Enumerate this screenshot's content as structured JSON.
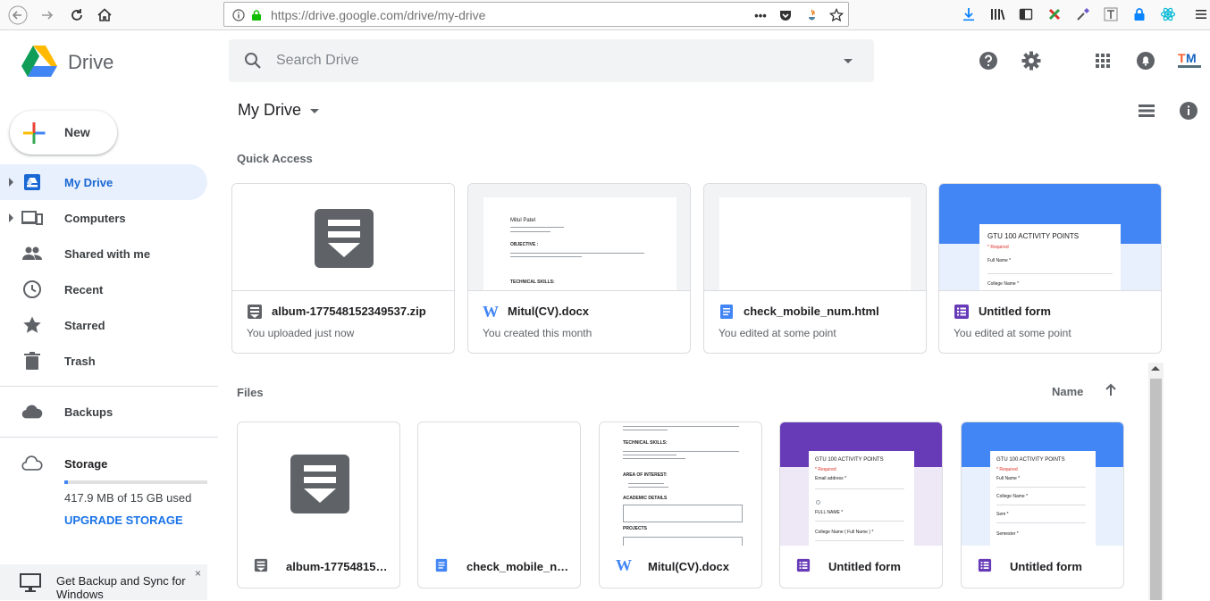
{
  "browser": {
    "url": "https://drive.google.com/drive/my-drive",
    "url_more": "•••"
  },
  "app": {
    "name": "Drive"
  },
  "search": {
    "placeholder": "Search Drive"
  },
  "sidebar": {
    "new_label": "New",
    "items": [
      {
        "label": "My Drive",
        "icon": "my-drive-icon",
        "active": true
      },
      {
        "label": "Computers",
        "icon": "computers-icon"
      },
      {
        "label": "Shared with me",
        "icon": "shared-icon"
      },
      {
        "label": "Recent",
        "icon": "clock-icon"
      },
      {
        "label": "Starred",
        "icon": "star-icon"
      },
      {
        "label": "Trash",
        "icon": "trash-icon"
      },
      {
        "label": "Backups",
        "icon": "cloud-icon"
      }
    ],
    "storage": {
      "label": "Storage",
      "used_text": "417.9 MB of 15 GB used",
      "used_fraction": 0.028,
      "upgrade_label": "UPGRADE STORAGE"
    },
    "backup_promo": {
      "text": "Get Backup and Sync for Windows",
      "close": "×"
    }
  },
  "main": {
    "title": "My Drive",
    "quick_access_title": "Quick Access",
    "files_title": "Files",
    "sort_label": "Name",
    "quick_access": [
      {
        "name": "album-177548152349537.zip",
        "sub": "You uploaded just now",
        "type": "archive"
      },
      {
        "name": "Mitul(CV).docx",
        "sub": "You created this month",
        "type": "word"
      },
      {
        "name": "check_mobile_num.html",
        "sub": "You edited at some point",
        "type": "doc"
      },
      {
        "name": "Untitled form",
        "sub": "You edited at some point",
        "type": "form"
      }
    ],
    "files": [
      {
        "name": "album-17754815…",
        "type": "archive"
      },
      {
        "name": "check_mobile_nu…",
        "type": "doc"
      },
      {
        "name": "Mitul(CV).docx",
        "type": "word"
      },
      {
        "name": "Untitled form",
        "type": "form"
      },
      {
        "name": "Untitled form",
        "type": "form"
      }
    ]
  },
  "thumbnails": {
    "cv": {
      "name": "Mitul Patel",
      "objective": "OBJECTIVE :",
      "skills": "TECHNICAL SKILLS:",
      "area": "AREA OF INTEREST:",
      "academic": "ACADEMIC DETAILS",
      "projects": "PROJECTS"
    },
    "form": {
      "title": "GTU 100 ACTIVITY POINTS",
      "required": "* Required",
      "field1": "Full Name *",
      "field2": "College Name *",
      "field_email": "Email address *",
      "field_full": "FULL NAME *",
      "field_college": "College Name ( Full Name ) *",
      "field3": "Sem *",
      "field4": "Semester *"
    }
  },
  "colors": {
    "accent": "#1a73e8",
    "active_bg": "#e8f0fe",
    "form_purple": "#673ab7",
    "form_blue": "#4285f4",
    "archive_gray": "#5f6368"
  }
}
